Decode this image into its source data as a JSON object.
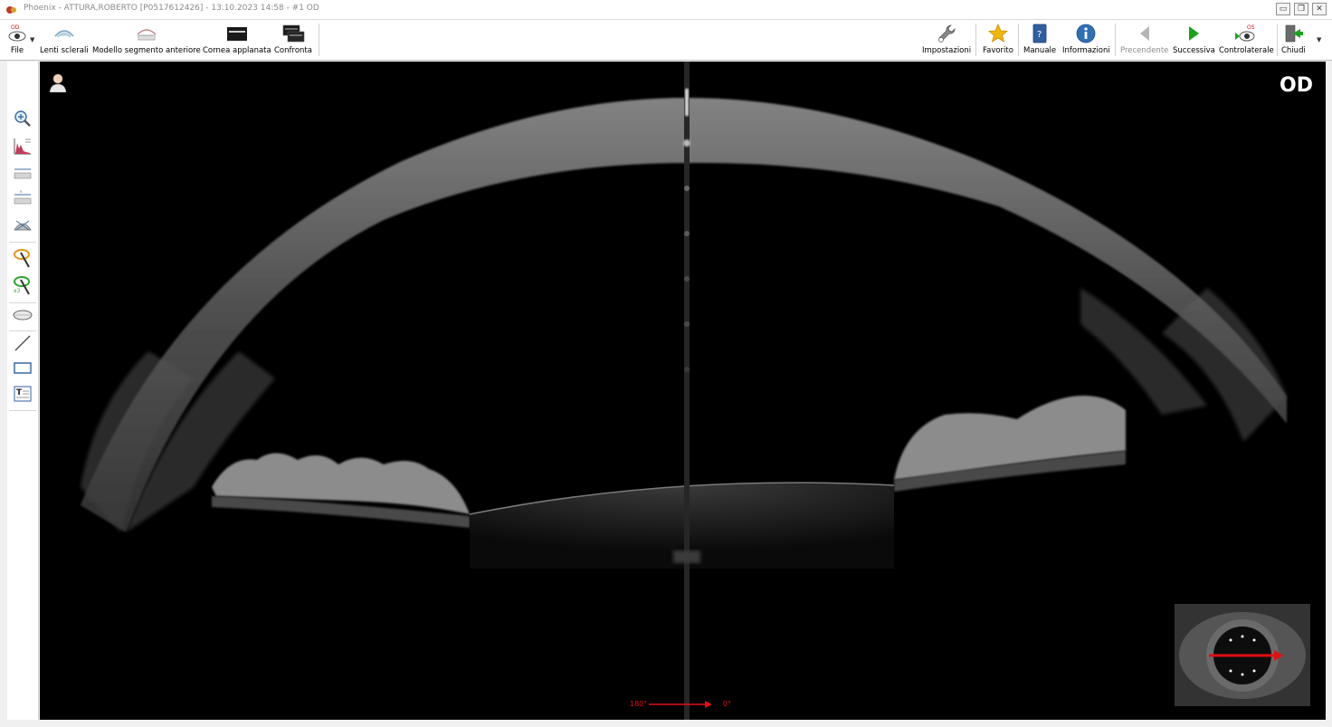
{
  "window": {
    "title": "Phoenix - ATTURA,ROBERTO [P0517612426] - 13.10.2023 14:58 - #1 OD"
  },
  "toolbar": {
    "left": [
      {
        "id": "file",
        "label": "File",
        "icon": "od-eye-icon"
      },
      {
        "id": "lenti",
        "label": "Lenti sclerali",
        "icon": "scleral-lens-icon"
      },
      {
        "id": "modello",
        "label": "Modello segmento anteriore",
        "icon": "anterior-segment-icon"
      },
      {
        "id": "cornea",
        "label": "Cornea applanata",
        "icon": "flat-cornea-icon"
      },
      {
        "id": "confronta",
        "label": "Confronta",
        "icon": "compare-icon"
      }
    ],
    "right": [
      {
        "id": "impostazioni",
        "label": "Impostazioni",
        "icon": "wrench-icon"
      },
      {
        "id": "favorito",
        "label": "Favorito",
        "icon": "star-icon"
      },
      {
        "id": "manuale",
        "label": "Manuale",
        "icon": "manual-icon"
      },
      {
        "id": "informazioni",
        "label": "Informazioni",
        "icon": "info-icon"
      },
      {
        "id": "precendente",
        "label": "Precendente",
        "icon": "arrow-left-icon"
      },
      {
        "id": "successiva",
        "label": "Successiva",
        "icon": "arrow-right-icon"
      },
      {
        "id": "controlaterale",
        "label": "Controlaterale",
        "icon": "os-eye-icon"
      },
      {
        "id": "chiudi",
        "label": "Chiudi",
        "icon": "exit-door-icon"
      }
    ],
    "file_badge": "OD",
    "contra_badge": "OS"
  },
  "viewer": {
    "eye": "OD",
    "axis_start": "180°",
    "axis_end": "0°"
  },
  "colors": {
    "accent_red": "#e01010",
    "star_yellow": "#f2b705",
    "nav_green": "#1aa31a",
    "info_blue": "#2f6fb6"
  }
}
